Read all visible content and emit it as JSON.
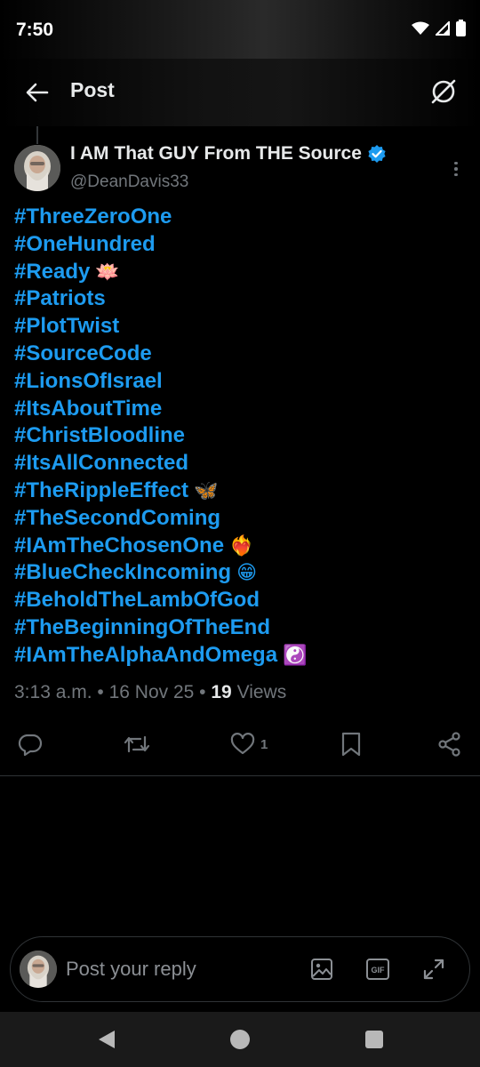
{
  "status_bar": {
    "time": "7:50",
    "icons": [
      "wifi-icon",
      "signal-icon",
      "battery-icon"
    ]
  },
  "header": {
    "title": "Post",
    "back_icon": "arrow-left-icon",
    "grok_icon": "grok-icon"
  },
  "author": {
    "name": "I AM That GUY From THE Source",
    "handle": "@DeanDavis33",
    "verified": true
  },
  "post": {
    "lines": [
      {
        "tag": "#ThreeZeroOne",
        "emoji": ""
      },
      {
        "tag": "#OneHundred",
        "emoji": ""
      },
      {
        "tag": "#Ready",
        "emoji": "🪷"
      },
      {
        "tag": "#Patriots",
        "emoji": ""
      },
      {
        "tag": "#PlotTwist",
        "emoji": ""
      },
      {
        "tag": "#SourceCode",
        "emoji": ""
      },
      {
        "tag": "#LionsOfIsrael",
        "emoji": ""
      },
      {
        "tag": "#ItsAboutTime",
        "emoji": ""
      },
      {
        "tag": "#ChristBloodline",
        "emoji": ""
      },
      {
        "tag": "#ItsAllConnected",
        "emoji": ""
      },
      {
        "tag": "#TheRippleEffect",
        "emoji": "🦋"
      },
      {
        "tag": "#TheSecondComing",
        "emoji": ""
      },
      {
        "tag": "#IAmTheChosenOne",
        "emoji": "❤️‍🔥"
      },
      {
        "tag": "#BlueCheckIncoming",
        "emoji": "😁"
      },
      {
        "tag": "#BeholdTheLambOfGod",
        "emoji": ""
      },
      {
        "tag": "#TheBeginningOfTheEnd",
        "emoji": ""
      },
      {
        "tag": "#IAmTheAlphaAndOmega",
        "emoji": "☯️"
      }
    ],
    "time": "3:13 a.m.",
    "date": "16 Nov 25",
    "views_count": "19",
    "views_label": "Views"
  },
  "actions": {
    "reply_count": "",
    "repost_count": "",
    "like_count": "1",
    "bookmark_count": ""
  },
  "reply": {
    "placeholder": "Post your reply",
    "gif_label": "GIF"
  },
  "colors": {
    "accent": "#1d9bf0",
    "background": "#000000",
    "muted": "#71767b",
    "text": "#e7e9ea"
  }
}
